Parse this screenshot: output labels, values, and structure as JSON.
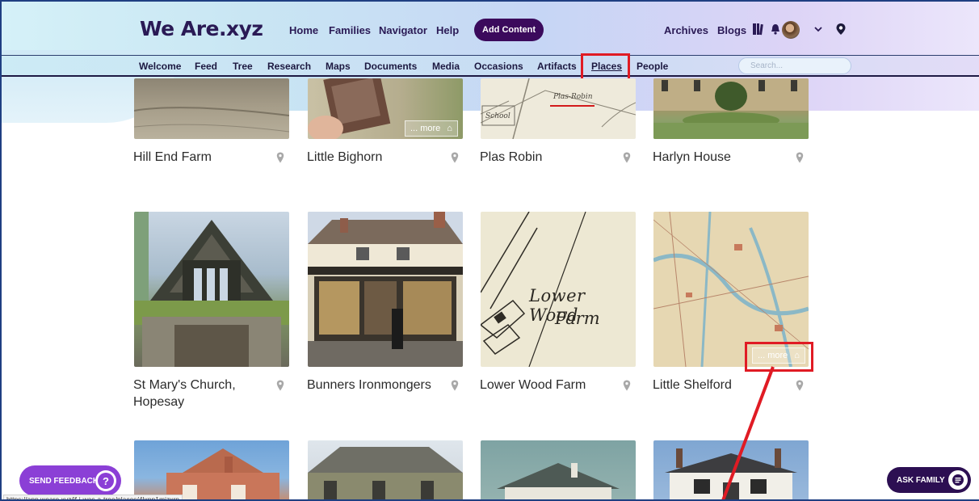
{
  "app": {
    "logo": "We Are.xyz"
  },
  "topnav": {
    "home": "Home",
    "families": "Families",
    "navigator": "Navigator",
    "help": "Help",
    "add_content": "Add Content",
    "archives": "Archives",
    "blogs": "Blogs"
  },
  "subnav": {
    "items": [
      "Welcome",
      "Feed",
      "Tree",
      "Research",
      "Maps",
      "Documents",
      "Media",
      "Occasions",
      "Artifacts",
      "Places",
      "People"
    ],
    "active": "Places",
    "search_placeholder": "Search..."
  },
  "places": {
    "row1": [
      {
        "title": "Hill End Farm"
      },
      {
        "title": "Little Bighorn",
        "more": "... more"
      },
      {
        "title": "Plas Robin",
        "map_labels": [
          "Plas-Robin",
          "School"
        ]
      },
      {
        "title": "Harlyn House"
      }
    ],
    "row2": [
      {
        "title_line1": "St Mary's Church,",
        "title_line2": "Hopesay"
      },
      {
        "title": "Bunners Ironmongers"
      },
      {
        "title": "Lower Wood Farm",
        "map_line1": "Lower Wood",
        "map_line2": "Farm"
      },
      {
        "title": "Little Shelford",
        "more": "... more"
      }
    ]
  },
  "buttons": {
    "send_feedback": "SEND FEEDBACK",
    "ask_family": "ASK FAMILY"
  },
  "status_url": "https://app.weare.xyz/if-i-was-a-tree/places/4lxpp1mjzxrp",
  "colors": {
    "brand_dark": "#2a1a55",
    "accent_purple": "#8b3fd6",
    "annotation_red": "#e01b24"
  }
}
